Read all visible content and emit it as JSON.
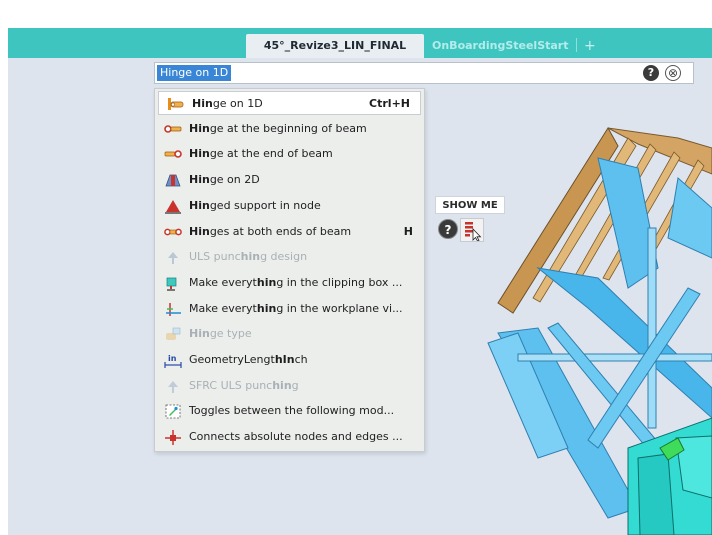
{
  "tabs": {
    "active": "45°_Revize3_LIN_FINAL",
    "inactive": "OnBoardingSteelStart",
    "add": "+"
  },
  "search": {
    "value": "Hinge on 1D",
    "help_glyph": "?",
    "close_glyph": "⊗"
  },
  "results": [
    {
      "pre": "",
      "bold": "Hin",
      "post": "ge on 1D",
      "shortcut": "Ctrl+H",
      "icon": "hinge-1d-icon",
      "disabled": false,
      "selected": true
    },
    {
      "pre": "",
      "bold": "Hin",
      "post": "ge at the beginning of beam",
      "shortcut": "",
      "icon": "hinge-begin-icon",
      "disabled": false
    },
    {
      "pre": "",
      "bold": "Hin",
      "post": "ge at the end of beam",
      "shortcut": "",
      "icon": "hinge-end-icon",
      "disabled": false
    },
    {
      "pre": "",
      "bold": "Hin",
      "post": "ge on 2D",
      "shortcut": "",
      "icon": "hinge-2d-icon",
      "disabled": false
    },
    {
      "pre": "",
      "bold": "Hin",
      "post": "ged support in node",
      "shortcut": "",
      "icon": "hinged-support-icon",
      "disabled": false
    },
    {
      "pre": "",
      "bold": "Hin",
      "post": "ges at both ends of beam",
      "shortcut": "H",
      "icon": "hinges-both-icon",
      "disabled": false
    },
    {
      "pre": "ULS punc",
      "bold": "hin",
      "post": "g design",
      "shortcut": "",
      "icon": "punching-icon",
      "disabled": true
    },
    {
      "pre": "Make everyt",
      "bold": "hin",
      "post": "g in the clipping box ...",
      "shortcut": "",
      "icon": "clipping-box-icon",
      "disabled": false
    },
    {
      "pre": "Make everyt",
      "bold": "hin",
      "post": "g in the workplane vi...",
      "shortcut": "",
      "icon": "workplane-icon",
      "disabled": false
    },
    {
      "pre": "",
      "bold": "Hin",
      "post": "ge type",
      "shortcut": "",
      "icon": "hinge-type-icon",
      "disabled": true
    },
    {
      "pre": "GeometryLengt",
      "bold": "hIn",
      "post": "ch",
      "shortcut": "",
      "icon": "inch-icon",
      "disabled": false
    },
    {
      "pre": "SFRC ULS punc",
      "bold": "hin",
      "post": "g",
      "shortcut": "",
      "icon": "sfrc-punching-icon",
      "disabled": true
    },
    {
      "pre": "Toggles between the following mod...",
      "bold": "",
      "post": "",
      "shortcut": "",
      "icon": "toggle-modes-icon",
      "disabled": false
    },
    {
      "pre": "Connects absolute nodes and edges ...",
      "bold": "",
      "post": "",
      "shortcut": "",
      "icon": "connect-nodes-icon",
      "disabled": false
    }
  ],
  "showme": {
    "label": "SHOW ME",
    "help_glyph": "?"
  },
  "colors": {
    "tabbar": "#3fc5c0",
    "viewport": "#dde4ee",
    "selection": "#3a86d6",
    "beam_cyan": "#5fc2f0",
    "timber": "#d6a766"
  }
}
